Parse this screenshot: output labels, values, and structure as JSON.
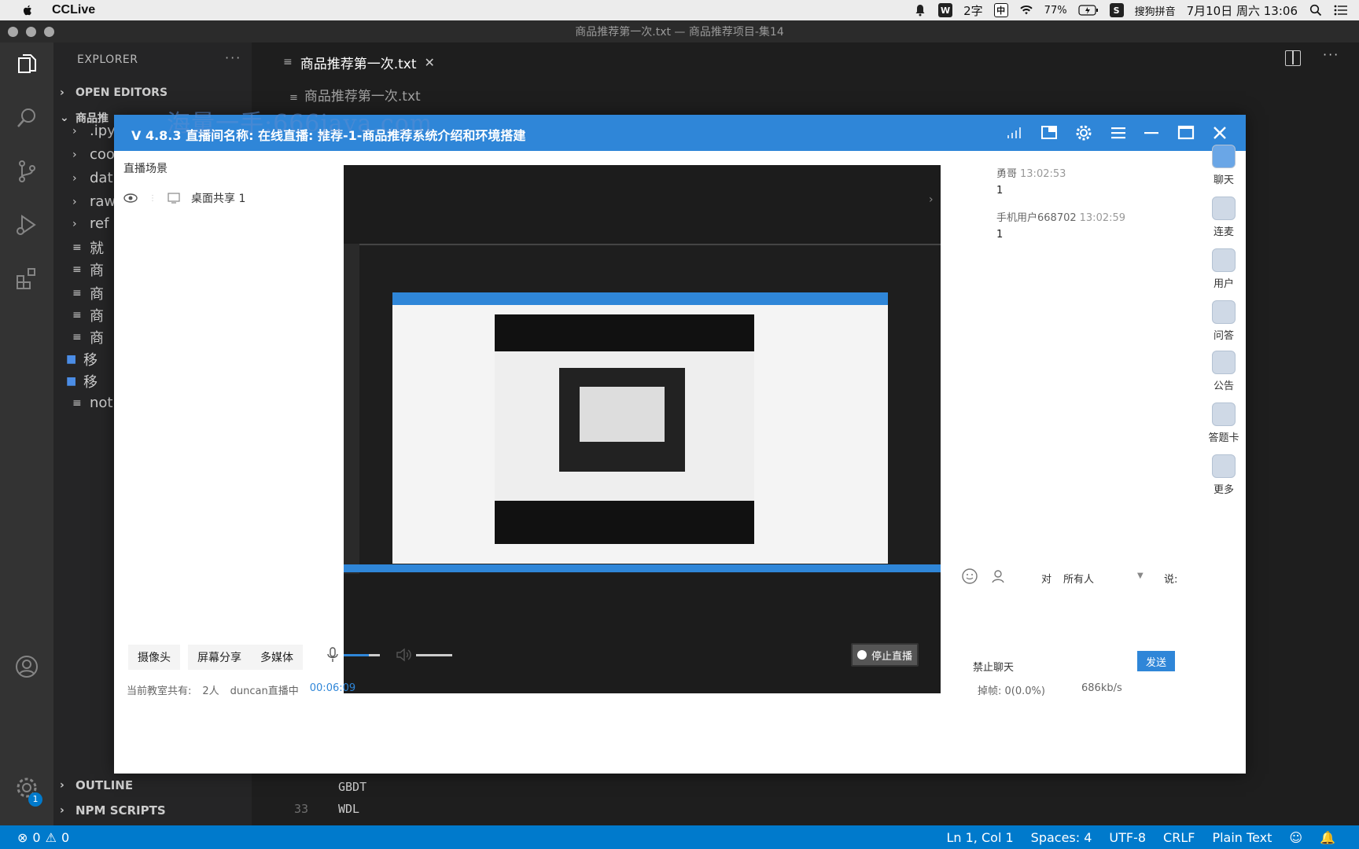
{
  "menubar": {
    "app_name": "CCLive",
    "input_count": "2字",
    "input_mode": "中",
    "battery": "77%",
    "ime_name": "搜狗拼音",
    "datetime": "7月10日 周六 13:06"
  },
  "window": {
    "title": "商品推荐第一次.txt — 商品推荐项目-集14"
  },
  "sidebar": {
    "header": "EXPLORER",
    "open_editors": "OPEN EDITORS",
    "project": "商品推",
    "items": [
      ".ipy",
      "coo",
      "dat",
      "raw",
      "ref",
      "就",
      "商",
      "商",
      "商",
      "商",
      "移",
      "移",
      "not"
    ],
    "outline": "OUTLINE",
    "npm": "NPM SCRIPTS"
  },
  "editor": {
    "tab_label": "商品推荐第一次.txt",
    "breadcrumb": "商品推荐第一次.txt",
    "code_line_1": "GBDT",
    "code_line_2": "WDL",
    "line_num": "33"
  },
  "statusbar": {
    "errors": "0",
    "warnings": "0",
    "position": "Ln 1, Col 1",
    "spaces": "Spaces: 4",
    "encoding": "UTF-8",
    "eol": "CRLF",
    "language": "Plain Text"
  },
  "cclive": {
    "title": "V 4.8.3  直播间名称:  在线直播:  推荐-1-商品推荐系统介绍和环境搭建",
    "scene_title": "直播场景",
    "scene_item": "桌面共享 1",
    "chat": [
      {
        "user": "勇哥",
        "time": "13:02:53",
        "text": "1"
      },
      {
        "user": "手机用户668702",
        "time": "13:02:59",
        "text": "1"
      }
    ],
    "tools": [
      "聊天",
      "连麦",
      "用户",
      "问答",
      "公告",
      "答题卡",
      "更多"
    ],
    "controls": {
      "camera": "摄像头",
      "screen_share": "屏幕分享",
      "media": "多媒体",
      "stop_live": "停止直播"
    },
    "chat_input": {
      "to_label": "对",
      "target": "所有人",
      "say": "说:",
      "mute": "禁止聊天",
      "send": "发送"
    },
    "status": {
      "room_count_label": "当前教室共有:",
      "room_count": "2人",
      "host_status": "duncan直播中",
      "timer": "00:06:09",
      "drop_label": "掉帧: 0(0.0%)",
      "bitrate": "686kb/s"
    },
    "watermark": "海量一手:666java.com"
  }
}
